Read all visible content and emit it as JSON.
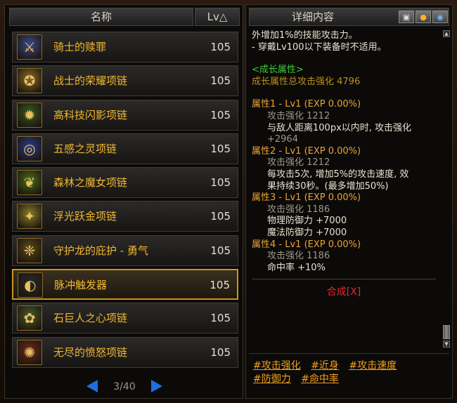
{
  "list": {
    "header_name": "名称",
    "header_lv": "Lv△",
    "items": [
      {
        "name": "骑士的赎罪",
        "lv": "105",
        "icon": "knight-necklace-icon",
        "color": "#3a4a8a"
      },
      {
        "name": "战士的荣耀项链",
        "lv": "105",
        "icon": "warrior-necklace-icon",
        "color": "#8a6a2a"
      },
      {
        "name": "高科技闪影项链",
        "lv": "105",
        "icon": "tech-necklace-icon",
        "color": "#3a5a20"
      },
      {
        "name": "五感之灵项链",
        "lv": "105",
        "icon": "five-senses-necklace-icon",
        "color": "#2a3a8a"
      },
      {
        "name": "森林之魔女项链",
        "lv": "105",
        "icon": "forest-witch-necklace-icon",
        "color": "#4a6a1a"
      },
      {
        "name": "浮光跃金项链",
        "lv": "105",
        "icon": "golden-light-necklace-icon",
        "color": "#8a7a2a"
      },
      {
        "name": "守护龙的庇护 - 勇气",
        "lv": "105",
        "icon": "dragon-necklace-icon",
        "color": "#5a4a1a"
      },
      {
        "name": "脉冲触发器",
        "lv": "105",
        "icon": "pulse-trigger-icon",
        "color": "#2a2a2a",
        "selected": true
      },
      {
        "name": "石巨人之心项链",
        "lv": "105",
        "icon": "golem-heart-necklace-icon",
        "color": "#4a5a2a"
      },
      {
        "name": "无尽的愤怒项链",
        "lv": "105",
        "icon": "endless-rage-necklace-icon",
        "color": "#6a2a1a"
      }
    ],
    "page": "3/40"
  },
  "detail": {
    "title": "详细内容",
    "lines": [
      {
        "text": "外增加1%的技能攻击力。",
        "cls": "w"
      },
      {
        "text": "- 穿戴Lv100以下装备时不适用。",
        "cls": "w"
      },
      {
        "text": "",
        "cls": "gap"
      },
      {
        "text": "<成长属性>",
        "cls": "g"
      },
      {
        "text": "成长属性总攻击强化 4796",
        "cls": "gd"
      },
      {
        "text": "",
        "cls": "gap"
      },
      {
        "text": "属性1 - Lv1 (EXP 0.00%)",
        "cls": "o"
      },
      {
        "text": "攻击强化 1212",
        "cls": "gr ind"
      },
      {
        "text": "与敌人距离100px以内时, 攻击强化",
        "cls": "w ind"
      },
      {
        "text": "+2964",
        "cls": "gr ind"
      },
      {
        "text": "属性2 - Lv1 (EXP 0.00%)",
        "cls": "o"
      },
      {
        "text": "攻击强化 1212",
        "cls": "gr ind"
      },
      {
        "text": "每攻击5次, 增加5%的攻击速度, 效",
        "cls": "w ind"
      },
      {
        "text": "果持续30秒。(最多增加50%)",
        "cls": "w ind"
      },
      {
        "text": "属性3 - Lv1 (EXP 0.00%)",
        "cls": "o"
      },
      {
        "text": "攻击强化 1186",
        "cls": "gr ind"
      },
      {
        "text": "物理防御力 +7000",
        "cls": "w ind"
      },
      {
        "text": "魔法防御力 +7000",
        "cls": "w ind"
      },
      {
        "text": "属性4 - Lv1 (EXP 0.00%)",
        "cls": "o"
      },
      {
        "text": "攻击强化 1186",
        "cls": "gr ind"
      },
      {
        "text": "命中率 +10%",
        "cls": "w ind"
      }
    ],
    "synth": "合成[X]",
    "tags": [
      "#攻击强化",
      "#近身",
      "#攻击速度",
      "#防御力",
      "#命中率"
    ]
  }
}
